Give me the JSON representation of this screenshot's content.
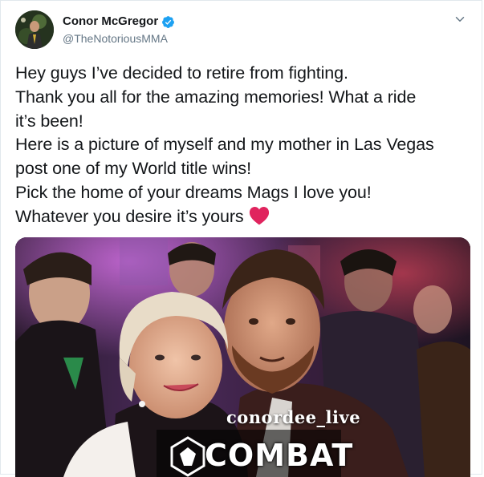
{
  "tweet": {
    "author": {
      "display_name": "Conor McGregor",
      "handle": "@TheNotoriousMMA",
      "verified": true,
      "avatar_icon": "avatar-icon"
    },
    "menu_icon": "chevron-down-icon",
    "text_lines": [
      "Hey guys I’ve decided to retire from fighting.",
      "Thank you all for the amazing memories! What a ride",
      "it’s been!",
      "Here is a picture of myself and my mother in Las Vegas",
      "post one of my World title wins!",
      "Pick the home of your dreams Mags I love you!",
      "Whatever you desire it’s yours"
    ],
    "emoji": "heart-icon",
    "media": {
      "watermark": "conordee_live",
      "logo_text": "COMBAT"
    }
  },
  "colors": {
    "text": "#14171a",
    "secondary": "#657786",
    "verified_blue": "#1da1f2",
    "heart_red": "#e0245e",
    "border": "#e1e8ed"
  }
}
